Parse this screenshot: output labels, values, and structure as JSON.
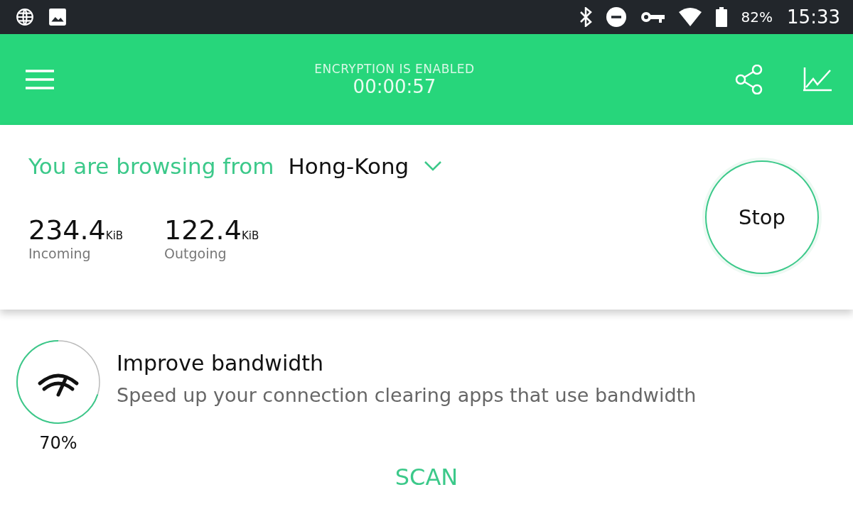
{
  "status_bar": {
    "battery": "82%",
    "time": "15:33"
  },
  "header": {
    "title": "ENCRYPTION IS ENABLED",
    "timer": "00:00:57"
  },
  "location": {
    "label": "You are browsing from",
    "value": "Hong-Kong"
  },
  "stats": [
    {
      "value": "234.4",
      "unit": "KiB",
      "label": "Incoming"
    },
    {
      "value": "122.4",
      "unit": "KiB",
      "label": "Outgoing"
    }
  ],
  "stop_button": "Stop",
  "tip": {
    "title": "Improve bandwidth",
    "text": "Speed up your connection clearing apps that use bandwidth",
    "reading": "70%"
  },
  "scan_button": "SCAN"
}
